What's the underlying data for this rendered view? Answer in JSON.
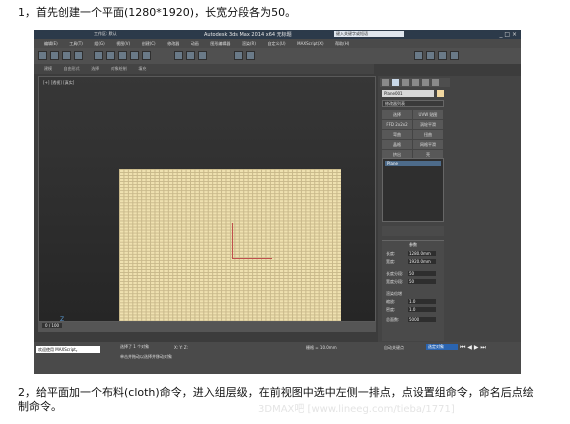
{
  "instructions": {
    "step1": "1，首先创建一个平面(1280*1920)，长宽分段各为50。",
    "step2": "2，给平面加一个布料(cloth)命令，进入组层级，在前视图中选中左侧一排点，点设置组命令，命名后点绘制命令。"
  },
  "screenshot": {
    "window_title": "Autodesk 3ds Max 2014 x64",
    "title_file": "无标题",
    "search_placeholder": "键入关键字或短语",
    "workspace": "工作区: 默认",
    "window_buttons": "_ □ ×",
    "menu_items": [
      "编辑(E)",
      "工具(T)",
      "组(G)",
      "视图(V)",
      "创建(C)",
      "修改器",
      "动画",
      "图形编辑器",
      "渲染(R)",
      "自定义(U)",
      "MAXScript(X)",
      "帮助(H)"
    ],
    "ribbon_tabs": [
      "建模",
      "自由形式",
      "选择",
      "对象绘制",
      "填充"
    ],
    "viewport_label": "[+] [透视] [真实]",
    "axis_label": "Z",
    "frame_counter": "0 / 100",
    "object_name": "Plane001",
    "modifier_list": "修改器列表",
    "modifier_buttons": [
      "选择",
      "UVW 贴图",
      "FFD 2x2x2",
      "涡轮平滑",
      "弯曲",
      "扭曲",
      "晶格",
      "网格平滑",
      "挤出",
      "壳"
    ],
    "stack_item": "Plane",
    "params": {
      "header": "参数",
      "length_label": "长度:",
      "length_value": "1280.0mm",
      "width_label": "宽度:",
      "width_value": "1920.0mm",
      "length_segs_label": "长度分段:",
      "length_segs_value": "50",
      "width_segs_label": "宽度分段:",
      "width_segs_value": "50",
      "render_mult_label": "渲染倍增",
      "scale_label": "缩放:",
      "scale_value": "1.0",
      "density_label": "密度:",
      "density_value": "1.0",
      "total_faces_label": "总面数:",
      "total_faces_value": "5000"
    },
    "bottom": {
      "maxscript": "欢迎使用 MAXScript。",
      "status_selected": "选择了 1 个对象",
      "status_hint": "单击并拖动以选择并移动对象",
      "coords": "X:   Y:   Z:",
      "grid": "栅格 = 10.0mm",
      "autokey": "自动关键点",
      "selection_set": "选定对象",
      "playback": "⏮ ◀ ▶ ⏭"
    },
    "watermark": "3DMAX吧 [www.lineeg.com/tieba/1771]"
  },
  "colors": {
    "plane": "#efe1b0",
    "grid_lines": "#c8b88a",
    "axis": "#c0504d"
  }
}
